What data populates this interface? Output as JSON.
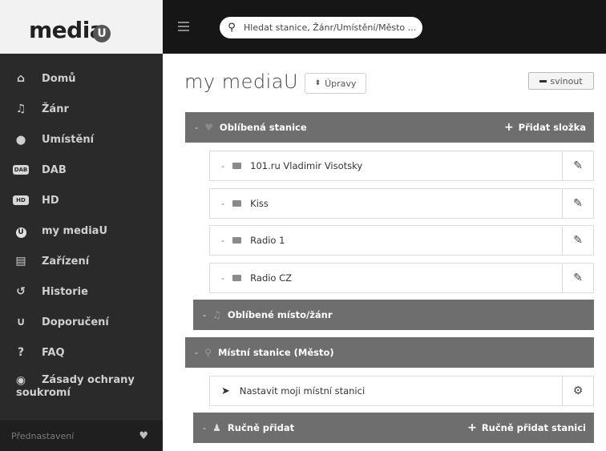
{
  "brand": {
    "logo_text": "media",
    "logo_u": "U"
  },
  "sidebar": {
    "items": [
      {
        "label": "Domů",
        "icon": "home-icon",
        "glyph": "⌂"
      },
      {
        "label": "Žánr",
        "icon": "music-note-icon",
        "glyph": "♫"
      },
      {
        "label": "Umístění",
        "icon": "map-pin-icon",
        "glyph": "⬤"
      },
      {
        "label": "DAB",
        "icon": "dab-icon",
        "glyph": "DAB"
      },
      {
        "label": "HD",
        "icon": "hd-icon",
        "glyph": "HD"
      },
      {
        "label": "my mediaU",
        "icon": "mediau-icon",
        "glyph": "U"
      },
      {
        "label": "Zařízení",
        "icon": "device-icon",
        "glyph": "▤"
      },
      {
        "label": "Historie",
        "icon": "history-icon",
        "glyph": "↺"
      },
      {
        "label": "Doporučení",
        "icon": "magnet-icon",
        "glyph": "∪"
      },
      {
        "label": "FAQ",
        "icon": "question-icon",
        "glyph": "?"
      },
      {
        "label_line1": "Zásady ochrany",
        "label_line2": "soukromí",
        "icon": "privacy-icon",
        "glyph": "◉"
      }
    ],
    "presets_label": "Přednastavení"
  },
  "search": {
    "placeholder": "Hledat stanice, Žánr/Umístění/Město ..."
  },
  "main": {
    "title": "my mediaU",
    "edit_label": "Úpravy",
    "collapse_label": "svinout",
    "favorites": {
      "label": "Oblíbená stanice",
      "action": "Přidat složka",
      "folders": [
        "101.ru Vladimir Visotsky",
        "Kiss",
        "Radio 1",
        "Radio CZ"
      ]
    },
    "fav_place_genre": {
      "label": "Oblíbené místo/žánr"
    },
    "local": {
      "label": "Místní stanice  (Město)",
      "row_label": "Nastavit moji místní stanici"
    },
    "manual": {
      "label": "Ručně přidat",
      "action": "Ručně přidat stanici"
    }
  }
}
